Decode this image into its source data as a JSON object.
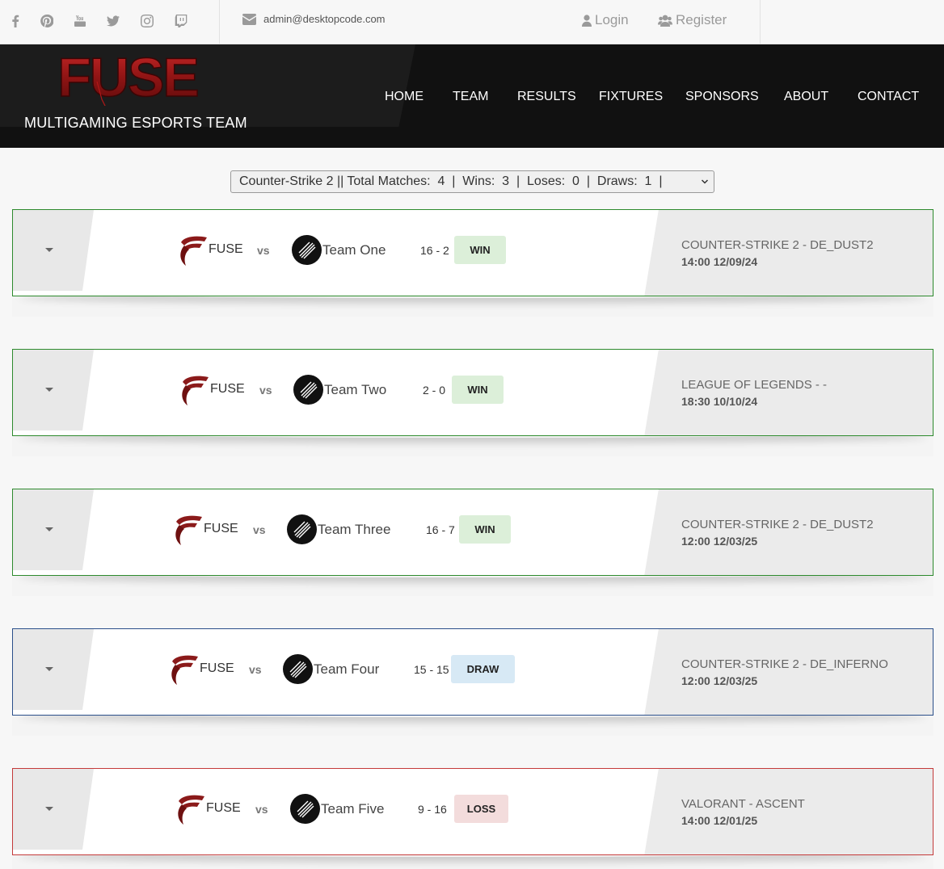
{
  "topbar": {
    "social": [
      {
        "icon": "facebook-icon"
      },
      {
        "icon": "pinterest-icon"
      },
      {
        "icon": "youtube-icon"
      },
      {
        "icon": "twitter-icon"
      },
      {
        "icon": "instagram-icon"
      },
      {
        "icon": "twitch-icon"
      }
    ],
    "email": "admin@desktopcode.com",
    "login_label": "Login",
    "register_label": "Register"
  },
  "header": {
    "logo_text": "FUSE",
    "tagline": "MULTIGAMING ESPORTS TEAM",
    "nav": [
      "HOME",
      "TEAM",
      "RESULTS",
      "FIXTURES",
      "SPONSORS",
      "ABOUT",
      "CONTACT"
    ]
  },
  "summary": {
    "text": "Counter-Strike 2 || Total Matches:  4  |  Wins:  3  |  Loses:  0  |  Draws:  1  |"
  },
  "colors": {
    "win_border": "#2d8a2d",
    "draw_border": "#2b4f8a",
    "loss_border": "#c43a3a",
    "brand_red": "#8b1a1a"
  },
  "matches": [
    {
      "home": "FUSE",
      "vs": "vs",
      "away": "Team One",
      "score": "16 - 2",
      "result": "WIN",
      "competition": "COUNTER-STRIKE 2 - DE_DUST2",
      "time": "14:00 12/09/24"
    },
    {
      "home": "FUSE",
      "vs": "vs",
      "away": "Team Two",
      "score": "2 - 0",
      "result": "WIN",
      "competition": "LEAGUE OF LEGENDS - -",
      "time": "18:30 10/10/24"
    },
    {
      "home": "FUSE",
      "vs": "vs",
      "away": "Team Three",
      "score": "16 - 7",
      "result": "WIN",
      "competition": "COUNTER-STRIKE 2 - DE_DUST2",
      "time": "12:00 12/03/25"
    },
    {
      "home": "FUSE",
      "vs": "vs",
      "away": "Team Four",
      "score": "15 - 15",
      "result": "DRAW",
      "competition": "COUNTER-STRIKE 2 - DE_INFERNO",
      "time": "12:00 12/03/25"
    },
    {
      "home": "FUSE",
      "vs": "vs",
      "away": "Team Five",
      "score": "9 - 16",
      "result": "LOSS",
      "competition": "VALORANT - ASCENT",
      "time": "14:00 12/01/25"
    }
  ]
}
